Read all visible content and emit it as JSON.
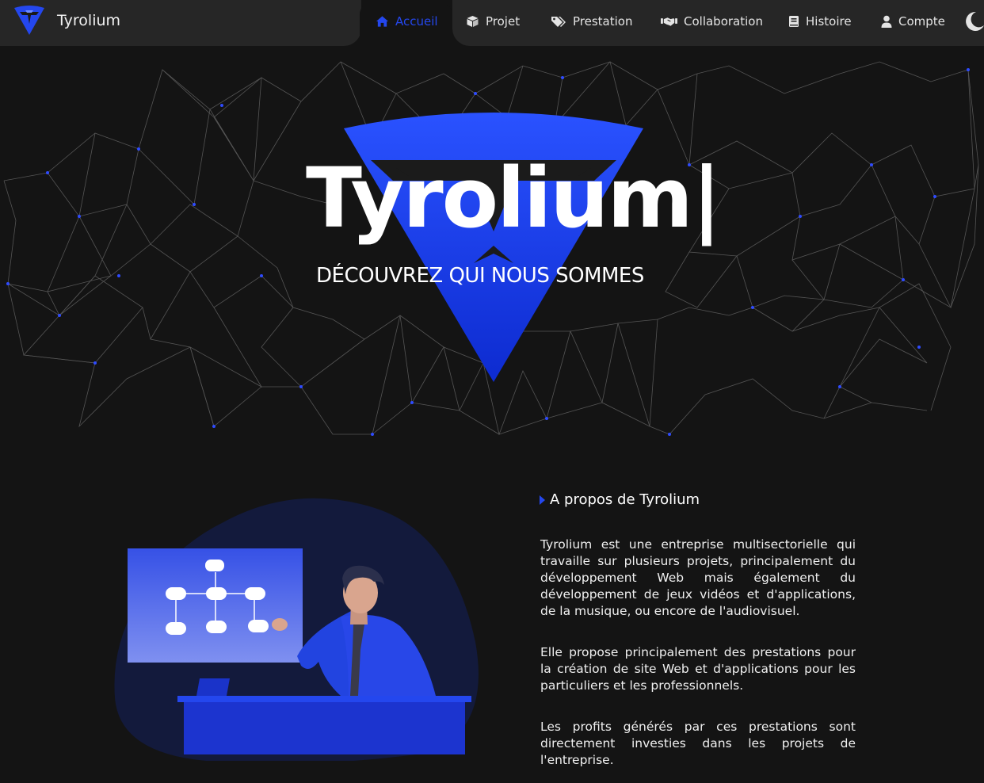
{
  "brand": {
    "name": "Tyrolium",
    "logo_icon": "tyrolium-logo-icon"
  },
  "nav": {
    "items": [
      {
        "label": "Accueil",
        "icon": "home-icon",
        "active": true
      },
      {
        "label": "Projet",
        "icon": "cube-icon",
        "active": false
      },
      {
        "label": "Prestation",
        "icon": "tags-icon",
        "active": false
      },
      {
        "label": "Collaboration",
        "icon": "handshake-icon",
        "active": false
      },
      {
        "label": "Histoire",
        "icon": "book-icon",
        "active": false
      },
      {
        "label": "Compte",
        "icon": "user-icon",
        "active": false
      }
    ],
    "theme_toggle_icon": "moon-icon"
  },
  "hero": {
    "title": "Tyrolium|",
    "subtitle": "DÉCOUVREZ QUI NOUS SOMMES"
  },
  "about": {
    "title": "A propos de Tyrolium",
    "paragraphs": [
      "Tyrolium est une entreprise multisectorielle qui travaille sur plusieurs projets, principalement du développement Web mais également du développement de jeux vidéos et d'applications, de la musique, ou encore de l'audiovisuel.",
      "Elle propose principalement des prestations pour la création de site Web et d'applications pour les particuliers et les professionnels.",
      "Les profits générés par ces prestations sont directement investies dans les projets de l'entreprise."
    ]
  },
  "colors": {
    "accent": "#2447ee",
    "background": "#141414",
    "navbar": "#262626",
    "text": "#ffffff"
  }
}
